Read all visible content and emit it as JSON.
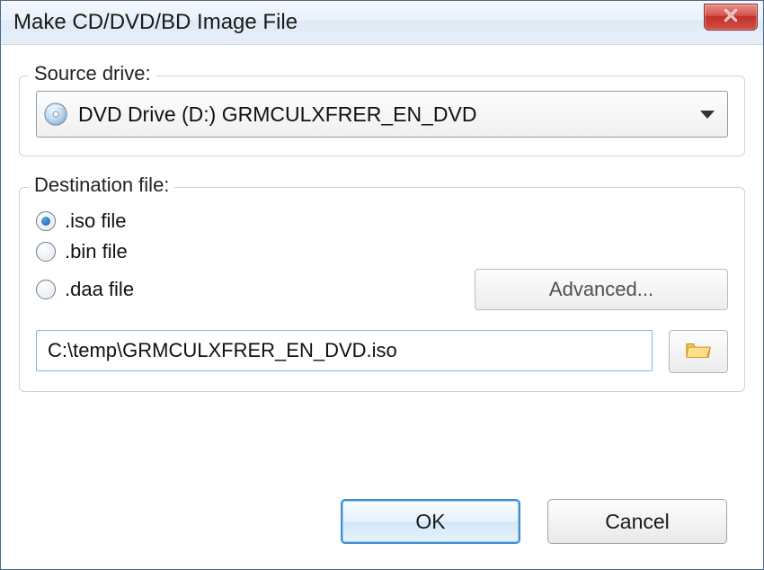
{
  "window": {
    "title": "Make CD/DVD/BD Image File"
  },
  "source": {
    "legend": "Source drive:",
    "drive_text": "DVD Drive (D:) GRMCULXFRER_EN_DVD"
  },
  "dest": {
    "legend": "Destination file:",
    "radios": {
      "iso": ".iso file",
      "bin": ".bin file",
      "daa": ".daa file"
    },
    "selected": "iso",
    "advanced_label": "Advanced...",
    "path_value": "C:\\temp\\GRMCULXFRER_EN_DVD.iso"
  },
  "buttons": {
    "ok": "OK",
    "cancel": "Cancel"
  },
  "icons": {
    "close": "close-icon",
    "disc": "disc-icon",
    "chevron_down": "chevron-down-icon",
    "folder": "folder-open-icon"
  },
  "colors": {
    "accent": "#3d8fd6",
    "close_red": "#c22f28",
    "border": "#c9d3de"
  }
}
